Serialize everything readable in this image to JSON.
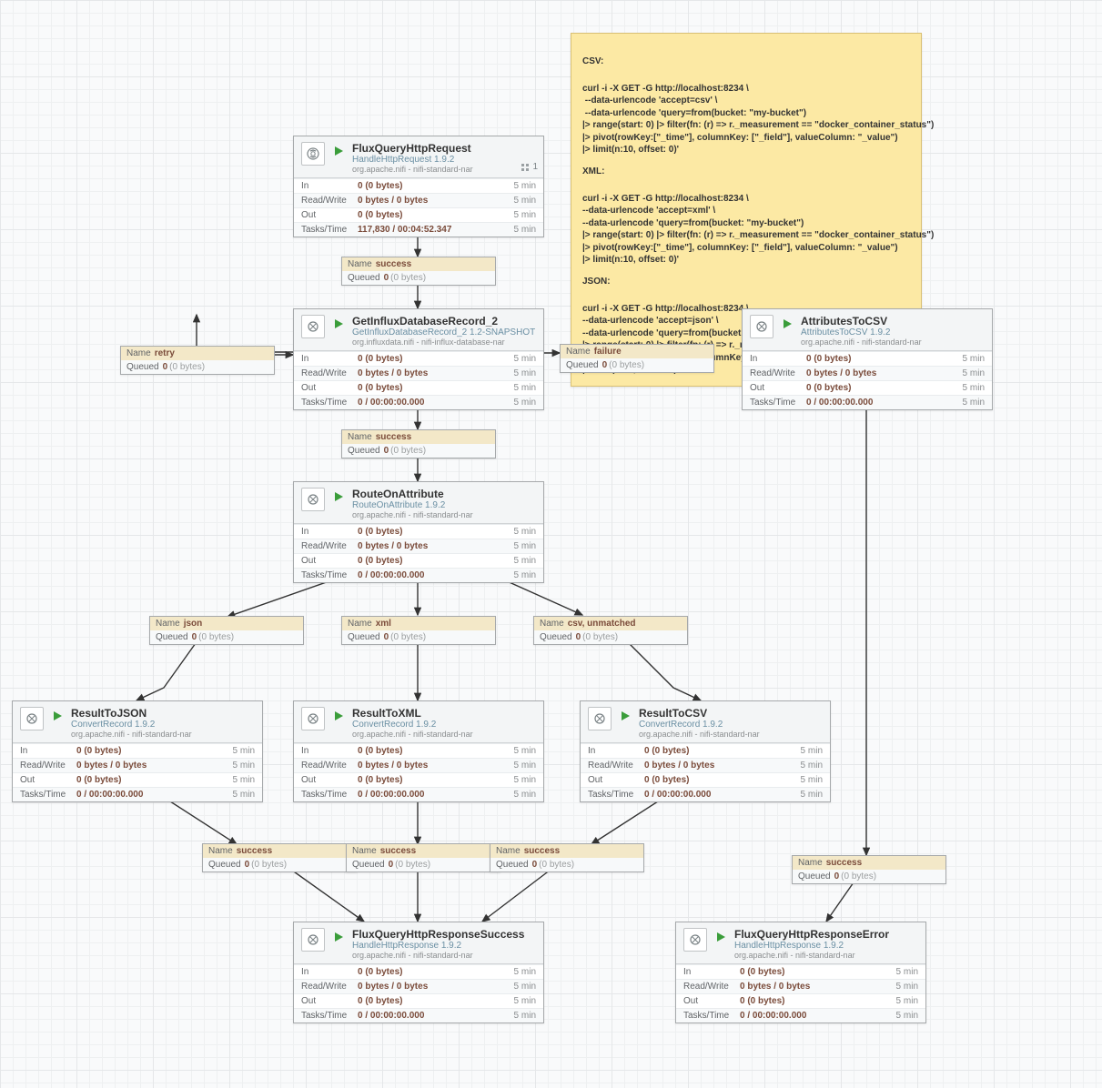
{
  "stats_labels": {
    "in": "In",
    "rw": "Read/Write",
    "out": "Out",
    "tt": "Tasks/Time",
    "time": "5 min",
    "name": "Name",
    "queued": "Queued"
  },
  "badge": {
    "count": "1"
  },
  "procs": {
    "p1": {
      "name": "FluxQueryHttpRequest",
      "type": "HandleHttpRequest 1.9.2",
      "bundle": "org.apache.nifi - nifi-standard-nar",
      "in": "0 (0 bytes)",
      "rw": "0 bytes / 0 bytes",
      "out": "0 (0 bytes)",
      "tt": "117,830 / 00:04:52.347"
    },
    "p2": {
      "name": "GetInfluxDatabaseRecord_2",
      "type": "GetInfluxDatabaseRecord_2 1.2-SNAPSHOT",
      "bundle": "org.influxdata.nifi - nifi-influx-database-nar",
      "in": "0 (0 bytes)",
      "rw": "0 bytes / 0 bytes",
      "out": "0 (0 bytes)",
      "tt": "0 / 00:00:00.000"
    },
    "p3": {
      "name": "AttributesToCSV",
      "type": "AttributesToCSV 1.9.2",
      "bundle": "org.apache.nifi - nifi-standard-nar",
      "in": "0 (0 bytes)",
      "rw": "0 bytes / 0 bytes",
      "out": "0 (0 bytes)",
      "tt": "0 / 00:00:00.000"
    },
    "p4": {
      "name": "RouteOnAttribute",
      "type": "RouteOnAttribute 1.9.2",
      "bundle": "org.apache.nifi - nifi-standard-nar",
      "in": "0 (0 bytes)",
      "rw": "0 bytes / 0 bytes",
      "out": "0 (0 bytes)",
      "tt": "0 / 00:00:00.000"
    },
    "p5": {
      "name": "ResultToJSON",
      "type": "ConvertRecord 1.9.2",
      "bundle": "org.apache.nifi - nifi-standard-nar",
      "in": "0 (0 bytes)",
      "rw": "0 bytes / 0 bytes",
      "out": "0 (0 bytes)",
      "tt": "0 / 00:00:00.000"
    },
    "p6": {
      "name": "ResultToXML",
      "type": "ConvertRecord 1.9.2",
      "bundle": "org.apache.nifi - nifi-standard-nar",
      "in": "0 (0 bytes)",
      "rw": "0 bytes / 0 bytes",
      "out": "0 (0 bytes)",
      "tt": "0 / 00:00:00.000"
    },
    "p7": {
      "name": "ResultToCSV",
      "type": "ConvertRecord 1.9.2",
      "bundle": "org.apache.nifi - nifi-standard-nar",
      "in": "0 (0 bytes)",
      "rw": "0 bytes / 0 bytes",
      "out": "0 (0 bytes)",
      "tt": "0 / 00:00:00.000"
    },
    "p8": {
      "name": "FluxQueryHttpResponseSuccess",
      "type": "HandleHttpResponse 1.9.2",
      "bundle": "org.apache.nifi - nifi-standard-nar",
      "in": "0 (0 bytes)",
      "rw": "0 bytes / 0 bytes",
      "out": "0 (0 bytes)",
      "tt": "0 / 00:00:00.000"
    },
    "p9": {
      "name": "FluxQueryHttpResponseError",
      "type": "HandleHttpResponse 1.9.2",
      "bundle": "org.apache.nifi - nifi-standard-nar",
      "in": "0 (0 bytes)",
      "rw": "0 bytes / 0 bytes",
      "out": "0 (0 bytes)",
      "tt": "0 / 00:00:00.000"
    }
  },
  "conns": {
    "c1": {
      "name": "success",
      "q": "0",
      "qb": "(0 bytes)"
    },
    "c2": {
      "name": "retry",
      "q": "0",
      "qb": "(0 bytes)"
    },
    "c3": {
      "name": "failure",
      "q": "0",
      "qb": "(0 bytes)"
    },
    "c4": {
      "name": "success",
      "q": "0",
      "qb": "(0 bytes)"
    },
    "c5": {
      "name": "json",
      "q": "0",
      "qb": "(0 bytes)"
    },
    "c6": {
      "name": "xml",
      "q": "0",
      "qb": "(0 bytes)"
    },
    "c7": {
      "name": "csv, unmatched",
      "q": "0",
      "qb": "(0 bytes)"
    },
    "c8": {
      "name": "success",
      "q": "0",
      "qb": "(0 bytes)"
    },
    "c9": {
      "name": "success",
      "q": "0",
      "qb": "(0 bytes)"
    },
    "c10": {
      "name": "success",
      "q": "0",
      "qb": "(0 bytes)"
    },
    "c11": {
      "name": "success",
      "q": "0",
      "qb": "(0 bytes)"
    }
  },
  "note": {
    "h1": "CSV:",
    "b1": "curl -i -X GET -G http://localhost:8234 \\\n --data-urlencode 'accept=csv' \\\n --data-urlencode 'query=from(bucket: \"my-bucket\")\n|> range(start: 0) |> filter(fn: (r) => r._measurement == \"docker_container_status\")\n|> pivot(rowKey:[\"_time\"], columnKey: [\"_field\"], valueColumn: \"_value\")\n|> limit(n:10, offset: 0)'",
    "h2": "XML:",
    "b2": "curl -i -X GET -G http://localhost:8234 \\\n--data-urlencode 'accept=xml' \\\n--data-urlencode 'query=from(bucket: \"my-bucket\")\n|> range(start: 0) |> filter(fn: (r) => r._measurement == \"docker_container_status\")\n|> pivot(rowKey:[\"_time\"], columnKey: [\"_field\"], valueColumn: \"_value\")\n|> limit(n:10, offset: 0)'",
    "h3": "JSON:",
    "b3": "curl -i -X GET -G http://localhost:8234 \\\n--data-urlencode 'accept=json' \\\n--data-urlencode 'query=from(bucket: \"my-bucket\")\n|> range(start: 0) |> filter(fn: (r) => r._measurement == \"docker_container_status\")\n|> pivot(rowKey:[\"_time\"], columnKey: [\"_field\"], valueColumn: \"_value\")\n|> limit(n:10, offset: 0)'"
  }
}
